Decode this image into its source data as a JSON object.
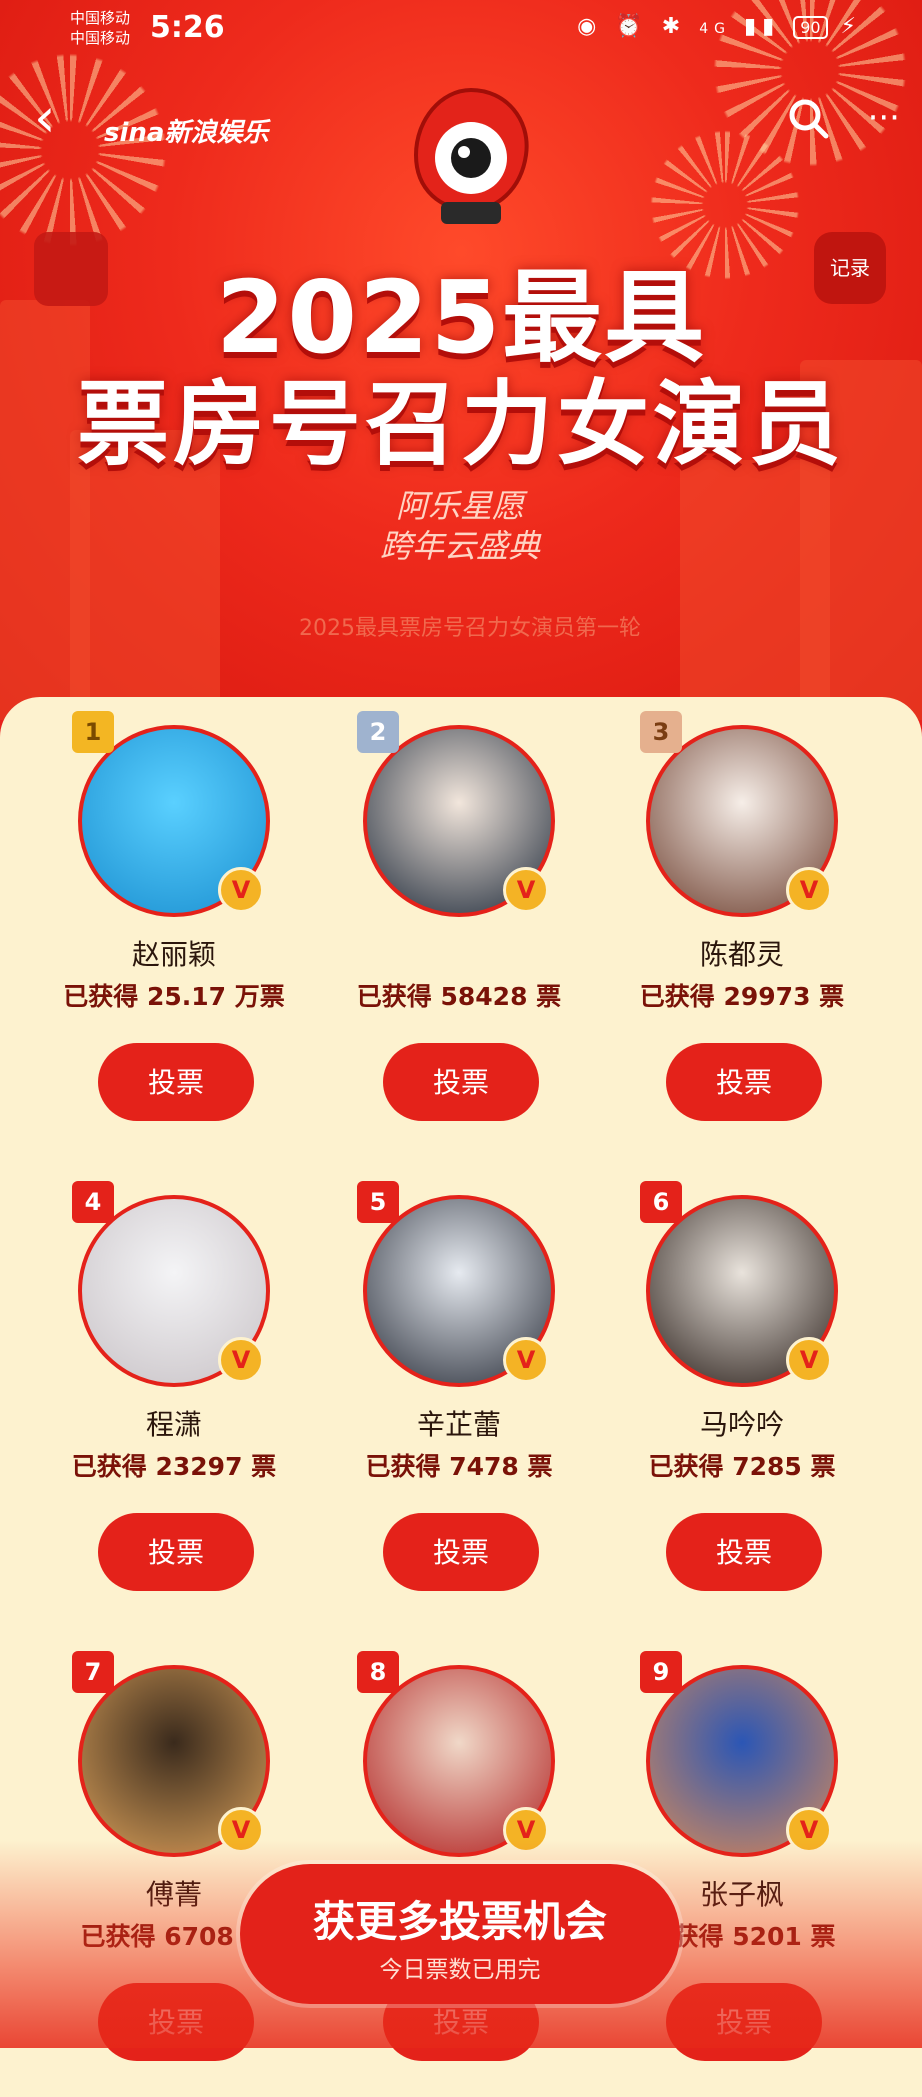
{
  "status_bar": {
    "carrier1": "中国移动",
    "carrier2": "中国移动",
    "time": "5:26",
    "network": "4G",
    "battery": "90"
  },
  "header": {
    "brand": "sina新浪娱乐",
    "record_label": "记录"
  },
  "hero": {
    "title_line1": "2025最具",
    "title_line2": "票房号召力女演员",
    "subtitle_line1": "阿乐星愿",
    "subtitle_line2": "跨年云盛典",
    "scroll_text": "2025最具票房号召力女演员第一轮"
  },
  "candidates": [
    {
      "rank": "1",
      "name": "赵丽颖",
      "votes": "已获得 25.17 万票",
      "vote_label": "投票"
    },
    {
      "rank": "2",
      "name": "",
      "votes": "已获得 58428 票",
      "vote_label": "投票"
    },
    {
      "rank": "3",
      "name": "陈都灵",
      "votes": "已获得 29973 票",
      "vote_label": "投票"
    },
    {
      "rank": "4",
      "name": "程潇",
      "votes": "已获得 23297 票",
      "vote_label": "投票"
    },
    {
      "rank": "5",
      "name": "辛芷蕾",
      "votes": "已获得 7478 票",
      "vote_label": "投票"
    },
    {
      "rank": "6",
      "name": "马吟吟",
      "votes": "已获得 7285 票",
      "vote_label": "投票"
    },
    {
      "rank": "7",
      "name": "傅菁",
      "votes": "已获得 6708 票",
      "vote_label": "投票"
    },
    {
      "rank": "8",
      "name": "",
      "votes": "",
      "vote_label": "投票"
    },
    {
      "rank": "9",
      "name": "张子枫",
      "votes": "已获得 5201 票",
      "vote_label": "投票"
    }
  ],
  "cta": {
    "main": "获更多投票机会",
    "sub": "今日票数已用完"
  },
  "colors": {
    "primary_red": "#e4221a",
    "panel_bg": "#fdf2cf",
    "gold": "#f3b623"
  }
}
